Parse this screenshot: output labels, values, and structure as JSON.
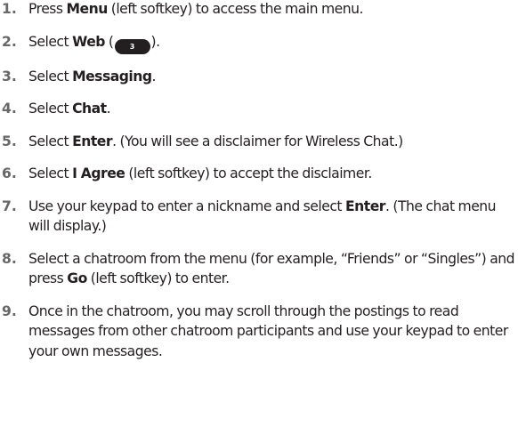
{
  "steps": [
    {
      "num": "1.",
      "pre": "Press ",
      "bold": "Menu",
      "post": " (left softkey) to access the main menu."
    },
    {
      "num": "2.",
      "pre": "Select ",
      "bold": "Web",
      "mid": " (",
      "key": "3",
      "post": ")."
    },
    {
      "num": "3.",
      "pre": "Select ",
      "bold": "Messaging",
      "post": "."
    },
    {
      "num": "4.",
      "pre": "Select ",
      "bold": "Chat",
      "post": "."
    },
    {
      "num": "5.",
      "pre": "Select ",
      "bold": "Enter",
      "post": ". (You will see a disclaimer for Wireless Chat.)"
    },
    {
      "num": "6.",
      "pre": "Select ",
      "bold": "I Agree",
      "post": " (left softkey) to accept the disclaimer."
    },
    {
      "num": "7.",
      "pre": "Use your keypad to enter a nickname and select ",
      "bold": "Enter",
      "post": ". (The chat menu will display.)"
    },
    {
      "num": "8.",
      "pre": "Select a chatroom from the menu (for example, “Friends” or “Singles”) and press ",
      "bold": "Go",
      "post": " (left softkey) to enter."
    },
    {
      "num": "9.",
      "text": "Once in the chatroom, you may scroll through the postings to read messages from other chatroom participants and use your keypad to enter your own messages."
    }
  ]
}
